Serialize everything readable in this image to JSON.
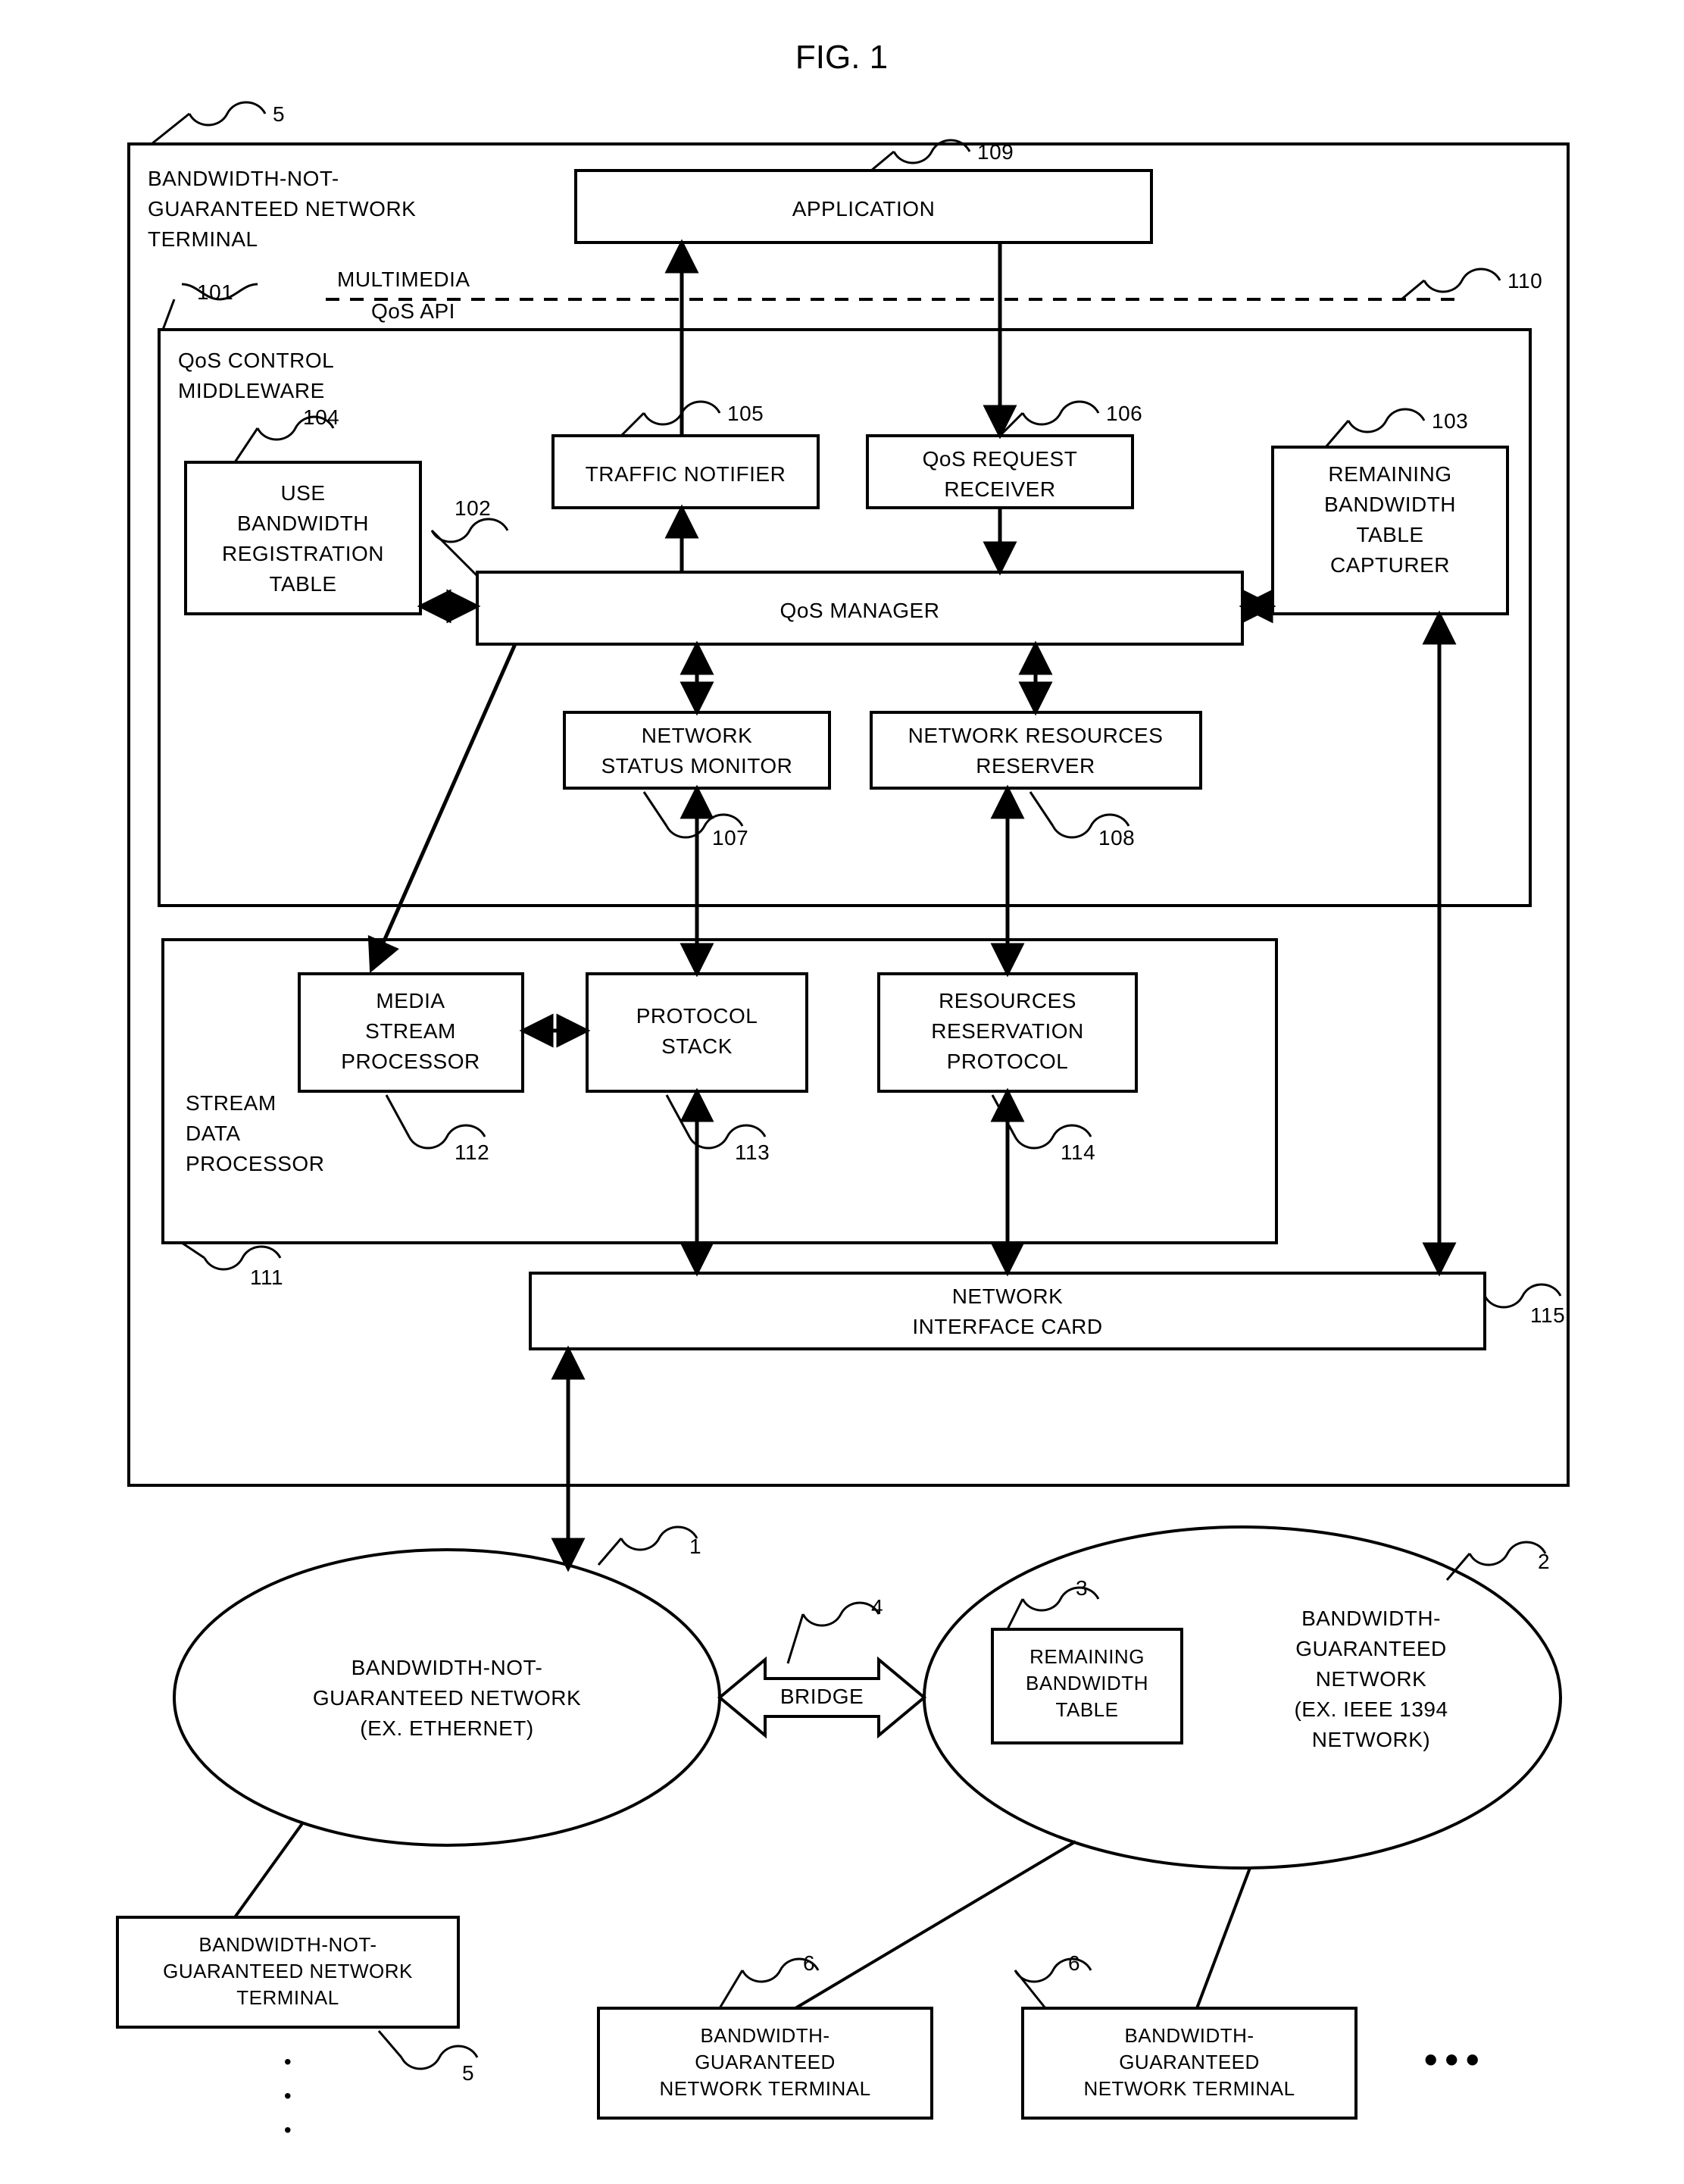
{
  "figure_title": "FIG. 1",
  "terminal_label_1": "BANDWIDTH-NOT-",
  "terminal_label_2": "GUARANTEED NETWORK",
  "terminal_label_3": "TERMINAL",
  "api_label": "MULTIMEDIA",
  "api_label2": "QoS API",
  "middleware_1": "QoS CONTROL",
  "middleware_2": "MIDDLEWARE",
  "application": "APPLICATION",
  "use_bw_1": "USE",
  "use_bw_2": "BANDWIDTH",
  "use_bw_3": "REGISTRATION",
  "use_bw_4": "TABLE",
  "traffic_notifier": "TRAFFIC NOTIFIER",
  "qos_req_1": "QoS REQUEST",
  "qos_req_2": "RECEIVER",
  "remaining_1": "REMAINING",
  "remaining_2": "BANDWIDTH",
  "remaining_3": "TABLE",
  "remaining_4": "CAPTURER",
  "qos_manager": "QoS MANAGER",
  "net_status_1": "NETWORK",
  "net_status_2": "STATUS MONITOR",
  "net_res_1": "NETWORK RESOURCES",
  "net_res_2": "RESERVER",
  "media_1": "MEDIA",
  "media_2": "STREAM",
  "media_3": "PROCESSOR",
  "proto_1": "PROTOCOL",
  "proto_2": "STACK",
  "resres_1": "RESOURCES",
  "resres_2": "RESERVATION",
  "resres_3": "PROTOCOL",
  "stream_1": "STREAM",
  "stream_2": "DATA",
  "stream_3": "PROCESSOR",
  "nic_1": "NETWORK",
  "nic_2": "INTERFACE CARD",
  "net1_1": "BANDWIDTH-NOT-",
  "net1_2": "GUARANTEED NETWORK",
  "net1_3": "(EX. ETHERNET)",
  "bridge": "BRIDGE",
  "rbt_1": "REMAINING",
  "rbt_2": "BANDWIDTH",
  "rbt_3": "TABLE",
  "net2_1": "BANDWIDTH-",
  "net2_2": "GUARANTEED",
  "net2_3": "NETWORK",
  "net2_4": "(EX. IEEE 1394",
  "net2_5": "NETWORK)",
  "bng_term_1": "BANDWIDTH-NOT-",
  "bng_term_2": "GUARANTEED NETWORK",
  "bng_term_3": "TERMINAL",
  "bg_term_1": "BANDWIDTH-",
  "bg_term_2": "GUARANTEED",
  "bg_term_3": "NETWORK TERMINAL",
  "ref_5a": "5",
  "ref_5b": "5",
  "ref_101": "101",
  "ref_102": "102",
  "ref_103": "103",
  "ref_104": "104",
  "ref_105": "105",
  "ref_106": "106",
  "ref_107": "107",
  "ref_108": "108",
  "ref_109": "109",
  "ref_110": "110",
  "ref_111": "111",
  "ref_112": "112",
  "ref_113": "113",
  "ref_114": "114",
  "ref_115": "115",
  "ref_1": "1",
  "ref_2": "2",
  "ref_3": "3",
  "ref_4": "4",
  "ref_6a": "6",
  "ref_6b": "6",
  "dots": "•••",
  "dots_v1": "•",
  "dots_v2": "•",
  "dots_v3": "•"
}
